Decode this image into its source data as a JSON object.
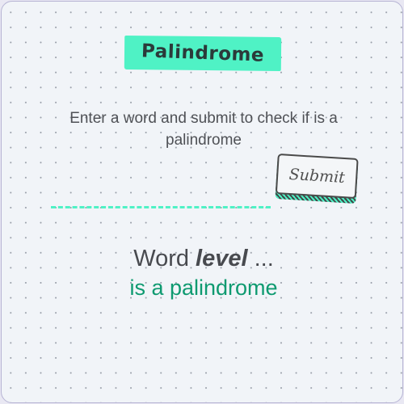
{
  "app": {
    "title": "Palindrome"
  },
  "instruction": "Enter a word and submit to check if is a palindrome",
  "input": {
    "value": "",
    "placeholder": ""
  },
  "submit": {
    "label": "Submit"
  },
  "result": {
    "prefix": "Word ",
    "word": "level",
    "suffix": " ...",
    "verdict": "is a palindrome"
  },
  "colors": {
    "accent": "#4ff2c5",
    "verdict_green": "#0e9a70",
    "text_dark": "#484a4f",
    "background": "#f1f4f8"
  }
}
